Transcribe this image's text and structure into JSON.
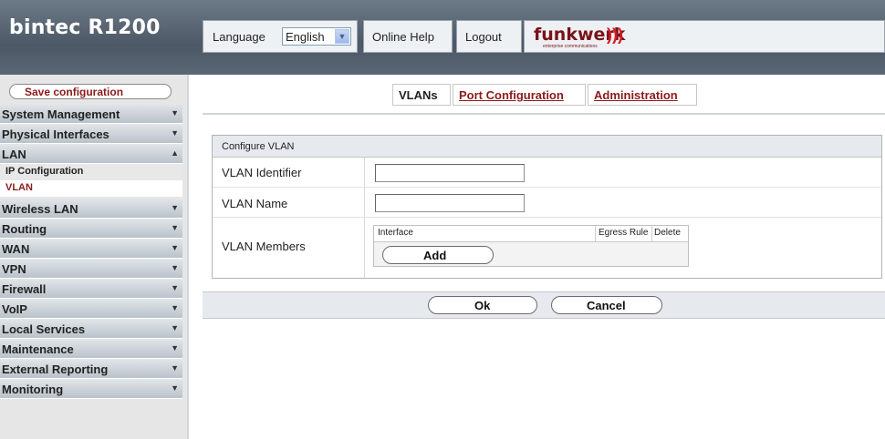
{
  "brand": {
    "title": "bintec R1200"
  },
  "topnav": {
    "language_label": "Language",
    "language_value": "English",
    "online_help": "Online Help",
    "logout": "Logout",
    "logo_text": "funkwerk",
    "logo_sub": "enterprise communications"
  },
  "sidebar": {
    "save": "Save configuration",
    "items": [
      {
        "label": "System Management"
      },
      {
        "label": "Physical Interfaces"
      },
      {
        "label": "LAN"
      },
      {
        "label": "Wireless LAN"
      },
      {
        "label": "Routing"
      },
      {
        "label": "WAN"
      },
      {
        "label": "VPN"
      },
      {
        "label": "Firewall"
      },
      {
        "label": "VoIP"
      },
      {
        "label": "Local Services"
      },
      {
        "label": "Maintenance"
      },
      {
        "label": "External Reporting"
      },
      {
        "label": "Monitoring"
      }
    ],
    "lan_sub": [
      {
        "label": "IP Configuration"
      },
      {
        "label": "VLAN"
      }
    ]
  },
  "tabs": [
    {
      "label": "VLANs"
    },
    {
      "label": "Port Configuration"
    },
    {
      "label": "Administration"
    }
  ],
  "form": {
    "section_title": "Configure VLAN",
    "vlan_identifier_label": "VLAN Identifier",
    "vlan_identifier_value": "",
    "vlan_name_label": "VLAN Name",
    "vlan_name_value": "",
    "members_label": "VLAN Members",
    "members_columns": [
      "Interface",
      "Egress Rule",
      "Delete"
    ],
    "add_button": "Add"
  },
  "actions": {
    "ok": "Ok",
    "cancel": "Cancel"
  }
}
